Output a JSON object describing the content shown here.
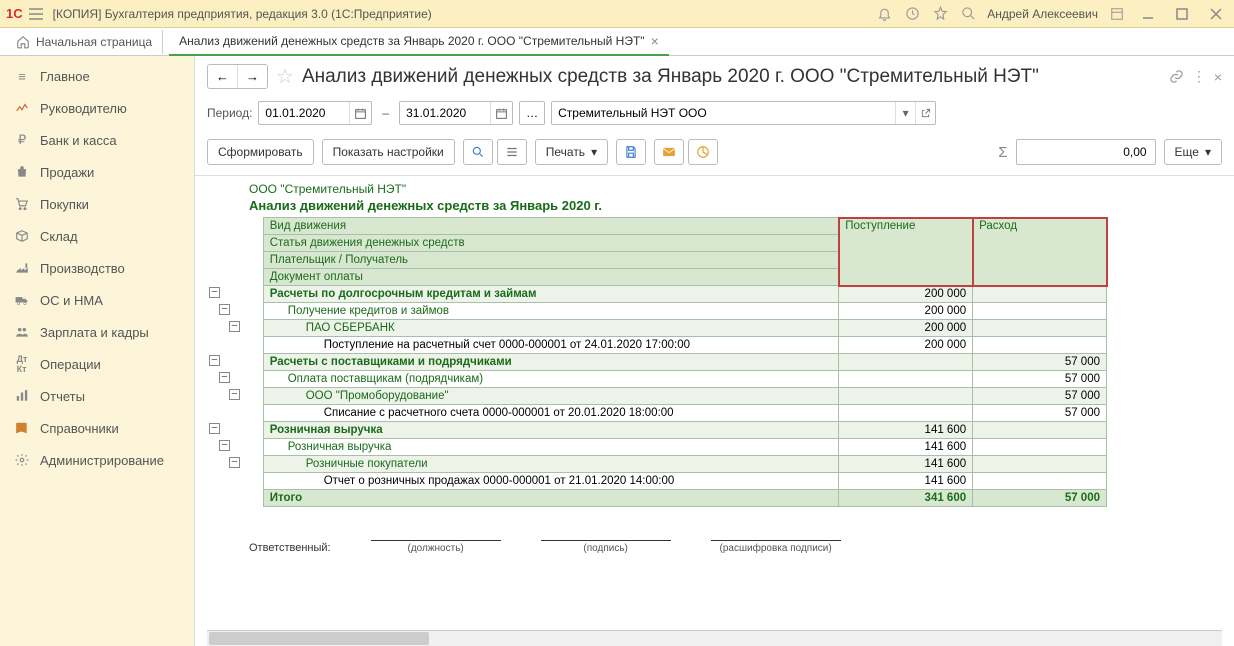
{
  "titlebar": {
    "title": "[КОПИЯ] Бухгалтерия предприятия, редакция 3.0  (1С:Предприятие)",
    "user": "Андрей Алексеевич"
  },
  "tabs": {
    "home": "Начальная страница",
    "doc": "Анализ движений денежных средств за Январь 2020 г. ООО \"Стремительный НЭТ\""
  },
  "sidebar": [
    {
      "label": "Главное"
    },
    {
      "label": "Руководителю"
    },
    {
      "label": "Банк и касса"
    },
    {
      "label": "Продажи"
    },
    {
      "label": "Покупки"
    },
    {
      "label": "Склад"
    },
    {
      "label": "Производство"
    },
    {
      "label": "ОС и НМА"
    },
    {
      "label": "Зарплата и кадры"
    },
    {
      "label": "Операции"
    },
    {
      "label": "Отчеты"
    },
    {
      "label": "Справочники"
    },
    {
      "label": "Администрирование"
    }
  ],
  "page": {
    "title": "Анализ движений денежных средств за Январь 2020 г. ООО \"Стремительный НЭТ\""
  },
  "period": {
    "label": "Период:",
    "from": "01.01.2020",
    "to": "31.01.2020",
    "org": "Стремительный НЭТ ООО",
    "dash": "–"
  },
  "toolbar": {
    "generate": "Сформировать",
    "showSettings": "Показать настройки",
    "print": "Печать",
    "more": "Еще",
    "sumValue": "0,00"
  },
  "report": {
    "org": "ООО \"Стремительный НЭТ\"",
    "title": "Анализ движений денежных средств за Январь 2020 г.",
    "headers": {
      "movementType": "Вид движения",
      "article": "Статья движения денежных средств",
      "payer": "Плательщик / Получатель",
      "payDoc": "Документ оплаты",
      "income": "Поступление",
      "expense": "Расход"
    },
    "rows": [
      {
        "lvl": 0,
        "label": "Расчеты по долгосрочным кредитам и займам",
        "in": "200 000",
        "out": "",
        "shade": true
      },
      {
        "lvl": 1,
        "label": "Получение кредитов и займов",
        "in": "200 000",
        "out": "",
        "shade": false
      },
      {
        "lvl": 2,
        "label": "ПАО СБЕРБАНК",
        "in": "200 000",
        "out": "",
        "shade": true
      },
      {
        "lvl": 3,
        "label": "Поступление на расчетный счет 0000-000001 от 24.01.2020 17:00:00",
        "in": "200 000",
        "out": "",
        "shade": false
      },
      {
        "lvl": 0,
        "label": "Расчеты с поставщиками и подрядчиками",
        "in": "",
        "out": "57 000",
        "shade": true
      },
      {
        "lvl": 1,
        "label": "Оплата поставщикам (подрядчикам)",
        "in": "",
        "out": "57 000",
        "shade": false
      },
      {
        "lvl": 2,
        "label": "ООО \"Промоборудование\"",
        "in": "",
        "out": "57 000",
        "shade": true
      },
      {
        "lvl": 3,
        "label": "Списание с расчетного счета 0000-000001 от 20.01.2020 18:00:00",
        "in": "",
        "out": "57 000",
        "shade": false
      },
      {
        "lvl": 0,
        "label": "Розничная выручка",
        "in": "141 600",
        "out": "",
        "shade": true
      },
      {
        "lvl": 1,
        "label": "Розничная выручка",
        "in": "141 600",
        "out": "",
        "shade": false
      },
      {
        "lvl": 2,
        "label": "Розничные покупатели",
        "in": "141 600",
        "out": "",
        "shade": true
      },
      {
        "lvl": 3,
        "label": "Отчет о розничных продажах 0000-000001 от 21.01.2020 14:00:00",
        "in": "141 600",
        "out": "",
        "shade": false
      }
    ],
    "total": {
      "label": "Итого",
      "in": "341 600",
      "out": "57 000"
    }
  },
  "footer": {
    "responsible": "Ответственный:",
    "position": "(должность)",
    "signature": "(подпись)",
    "name": "(расшифровка подписи)"
  }
}
